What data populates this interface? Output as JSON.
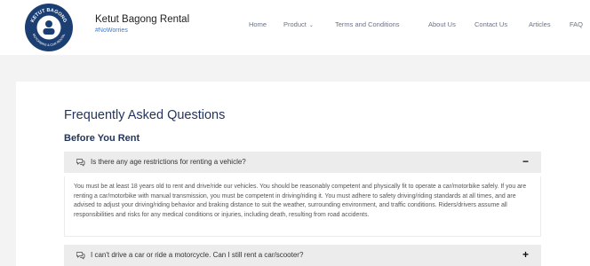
{
  "brand": {
    "logo_text_top": "KETUT BAGONG",
    "logo_text_bottom": "MOTORBIKE & CAR RENTAL",
    "name": "Ketut Bagong Rental",
    "tagline": "#NoWorries"
  },
  "nav": {
    "items": [
      {
        "label": "Home"
      },
      {
        "label": "Product",
        "chevron": "⌄"
      },
      {
        "label": "Terms and Conditions"
      },
      {
        "label": "About Us"
      },
      {
        "label": "Contact Us"
      },
      {
        "label": "Articles"
      },
      {
        "label": "FAQ"
      }
    ]
  },
  "page": {
    "title": "Frequently Asked Questions",
    "section": "Before You Rent"
  },
  "faq": [
    {
      "question": "Is there any age restrictions for renting a vehicle?",
      "toggle": "−",
      "expanded": true,
      "answer": "You must be at least 18 years old to rent and drive/ride our vehicles. You should be reasonably competent and physically fit to operate a car/motorbike safely. If you are renting a car/motorbike with manual transmission, you must be competent in driving/riding it. You must adhere to safety driving/riding standards at all times, and are advised to adjust your driving/riding behavior and braking distance to suit the weather, surrounding environment, and traffic conditions. Riders/drivers assume all responsibilities and risks for any medical conditions or injuries, including death, resulting from road accidents."
    },
    {
      "question": "I can't drive a car or ride a motorcycle. Can I still rent a car/scooter?",
      "toggle": "+",
      "expanded": false
    }
  ],
  "colors": {
    "heading": "#23355c",
    "tagline": "#3a7bd5",
    "accordion_bg": "#ececec",
    "logo_bg": "#1c3f73"
  },
  "icons": {
    "question": "speech-bubbles-icon"
  }
}
